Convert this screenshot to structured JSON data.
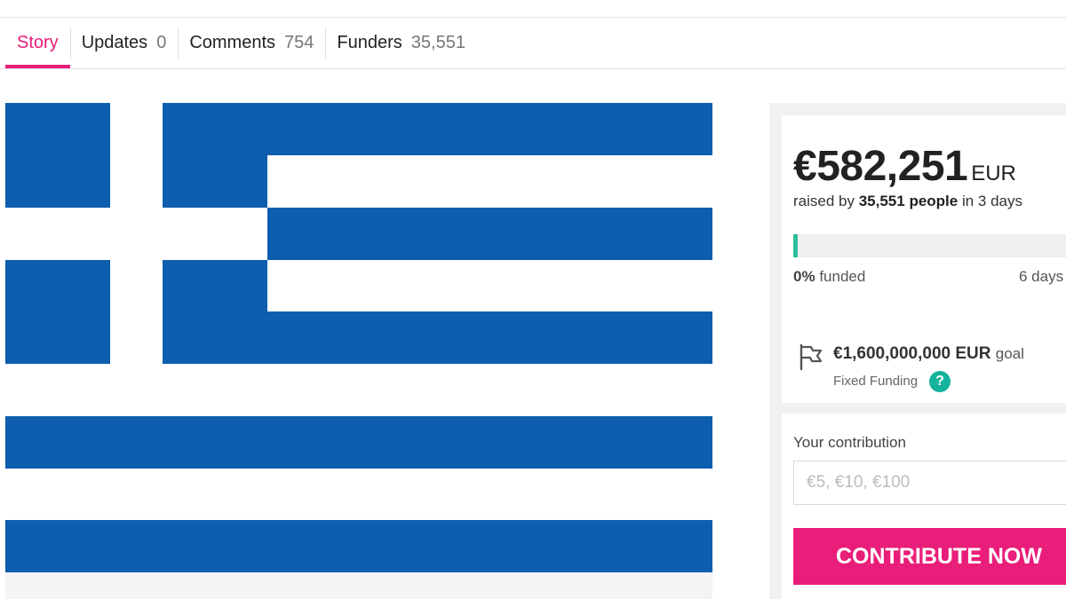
{
  "tabs": [
    {
      "label": "Story",
      "count": ""
    },
    {
      "label": "Updates",
      "count": "0"
    },
    {
      "label": "Comments",
      "count": "754"
    },
    {
      "label": "Funders",
      "count": "35,551"
    }
  ],
  "campaign": {
    "amount_raised": "€582,251",
    "currency": "EUR",
    "raised_prefix": "raised by",
    "raised_people": "35,551 people",
    "raised_suffix": "in 3 days",
    "progress_fraction": 0.0004,
    "funded_percent": "0%",
    "funded_word": "funded",
    "days_left": "6 days",
    "goal_amount": "€1,600,000,000 EUR",
    "goal_word": "goal",
    "funding_type": "Fixed Funding"
  },
  "contribution": {
    "label": "Your contribution",
    "placeholder": "€5, €10, €100",
    "button_label": "CONTRIBUTE NOW"
  },
  "icons": {
    "goal": "flag-icon",
    "help": "question-mark-icon"
  },
  "colors": {
    "accent": "#e91e7a",
    "progress": "#2bbd9a",
    "help_badge": "#15b39c",
    "flag_blue": "#0d5eaf",
    "flag_white": "#ffffff"
  }
}
